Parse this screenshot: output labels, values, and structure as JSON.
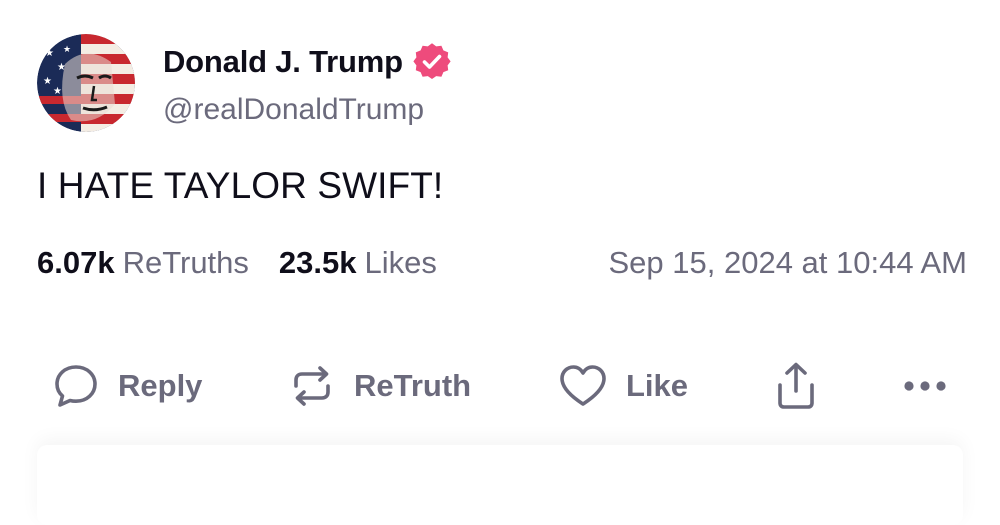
{
  "author": {
    "name": "Donald J. Trump",
    "handle": "@realDonaldTrump",
    "verified": true,
    "verified_color": "#ee4b7c"
  },
  "post": {
    "text": "I HATE TAYLOR SWIFT!"
  },
  "stats": {
    "retruths_count": "6.07k",
    "retruths_label": "ReTruths",
    "likes_count": "23.5k",
    "likes_label": "Likes",
    "timestamp": "Sep 15, 2024 at 10:44 AM"
  },
  "actions": [
    {
      "label": "Reply",
      "icon": "speech-bubble-icon"
    },
    {
      "label": "ReTruth",
      "icon": "repost-arrows-icon"
    },
    {
      "label": "Like",
      "icon": "heart-icon"
    },
    {
      "label": "",
      "icon": "share-icon"
    },
    {
      "label": "",
      "icon": "more-dots-icon"
    }
  ],
  "colors": {
    "text_primary": "#0f0e1a",
    "text_muted": "#6b6a7c",
    "background": "#ffffff"
  }
}
